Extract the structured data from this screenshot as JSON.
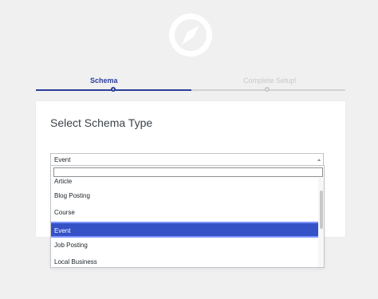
{
  "steps": {
    "step1": "Schema",
    "step2": "Complete Setup!"
  },
  "card": {
    "title": "Select Schema Type",
    "selected_value": "Event"
  },
  "dropdown": {
    "search_placeholder": "",
    "options": [
      "Article",
      "Blog Posting",
      "Course",
      "Event",
      "Job Posting",
      "Local Business"
    ],
    "selected_option": "Event"
  },
  "icons": {
    "logo": "compass-icon",
    "select_arrow": "chevron-up-icon"
  },
  "colors": {
    "accent": "#2c3e98",
    "selected_option_bg": "#3451c6"
  }
}
